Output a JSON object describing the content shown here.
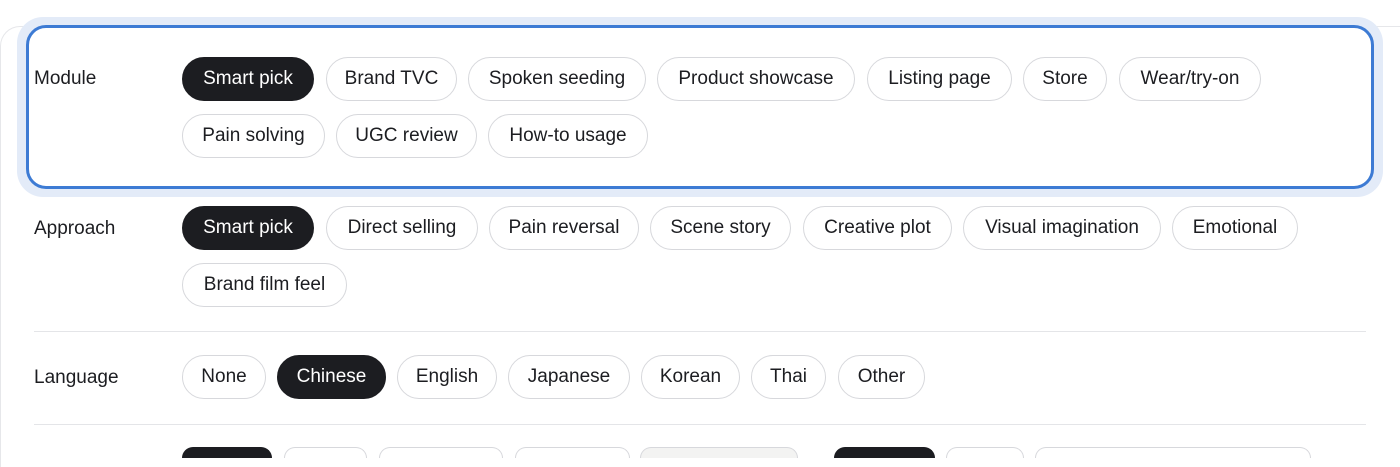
{
  "module": {
    "label": "Module",
    "options": [
      "Smart pick",
      "Brand TVC",
      "Spoken seeding",
      "Product showcase",
      "Listing page",
      "Store",
      "Wear/try-on",
      "Pain solving",
      "UGC review",
      "How-to usage"
    ],
    "selected": "Smart pick"
  },
  "approach": {
    "label": "Approach",
    "options": [
      "Smart pick",
      "Direct selling",
      "Pain reversal",
      "Scene story",
      "Creative plot",
      "Visual imagination",
      "Emotional",
      "Brand film feel"
    ],
    "selected": "Smart pick"
  },
  "language": {
    "label": "Language",
    "options": [
      "None",
      "Chinese",
      "English",
      "Japanese",
      "Korean",
      "Thai",
      "Other"
    ],
    "selected": "Chinese"
  },
  "colors": {
    "selected_chip": "#1c1d21",
    "focus_border": "#3d7bd4"
  }
}
